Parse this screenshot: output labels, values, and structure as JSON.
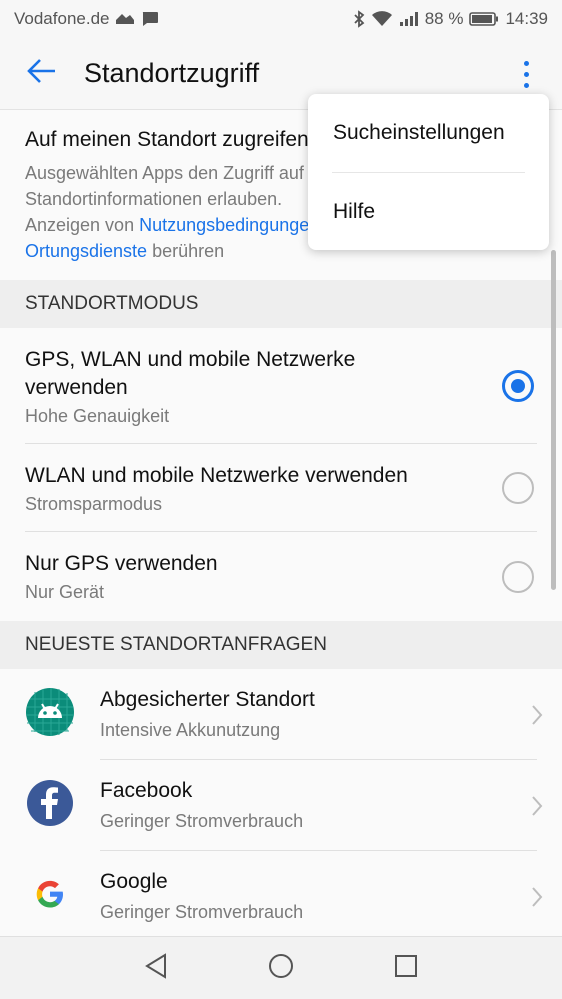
{
  "status": {
    "carrier": "Vodafone.de",
    "battery": "88 %",
    "time": "14:39"
  },
  "appbar": {
    "title": "Standortzugriff",
    "back_icon": "back-arrow-icon",
    "more_icon": "more-vert-icon"
  },
  "description": {
    "title": "Auf meinen Standort zugreifen",
    "line1": "Ausgewählten Apps den Zugriff auf",
    "line2": "Standortinformationen erlauben.",
    "line3_prefix": "Anzeigen von ",
    "link1": "Nutzungsbedingungen",
    "link2": "Ortungsdienste",
    "line4_suffix": " berühren"
  },
  "mode_section": {
    "header": "STANDORTMODUS",
    "options": [
      {
        "label_line1": "GPS, WLAN und mobile Netzwerke",
        "label_line2": "verwenden",
        "sub": "Hohe Genauigkeit",
        "selected": true
      },
      {
        "label": "WLAN und mobile Netzwerke verwenden",
        "sub": "Stromsparmodus",
        "selected": false
      },
      {
        "label": "Nur GPS verwenden",
        "sub": "Nur Gerät",
        "selected": false
      }
    ]
  },
  "requests_section": {
    "header": "NEUESTE STANDORTANFRAGEN",
    "apps": [
      {
        "name": "Abgesicherter Standort",
        "sub": "Intensive Akkunutzung",
        "icon": "android-icon"
      },
      {
        "name": "Facebook",
        "sub": "Geringer Stromverbrauch",
        "icon": "facebook-icon"
      },
      {
        "name": "Google",
        "sub": "Geringer Stromverbrauch",
        "icon": "google-icon"
      }
    ]
  },
  "menu": {
    "items": [
      "Sucheinstellungen",
      "Hilfe"
    ]
  },
  "colors": {
    "accent": "#1a73e8",
    "android_bg": "#0b8c7a",
    "facebook": "#3b5998"
  }
}
